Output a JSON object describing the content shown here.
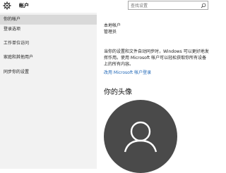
{
  "titlebar": {
    "icon": "gear-icon",
    "title": "帐户",
    "search_placeholder": "查找设置"
  },
  "sidebar": {
    "items": [
      {
        "label": "你的帐户",
        "selected": true
      },
      {
        "label": "登录选项",
        "selected": false
      },
      {
        "label": "工作单位访问",
        "selected": false
      },
      {
        "label": "家庭和其他用户",
        "selected": false
      },
      {
        "label": "同步你的设置",
        "selected": false
      }
    ]
  },
  "content": {
    "account_type": "本地帐户",
    "role": "管理员",
    "sync_text_line1": "当你的设置和文件自动同步时，Windows 可以更好地发",
    "sync_text_line2": "挥作用。使用 Microsoft 帐户可以轻松获取你所有设备",
    "sync_text_line3": "上的所有内容。",
    "ms_account_link": "改用 Microsoft 帐户登录",
    "avatar_heading": "你的头像"
  },
  "colors": {
    "sidebar_bg": "#f2f2f2",
    "selected_bg": "#d9d9d9",
    "link": "#1e66b6",
    "avatar_bg": "#4a4a4a"
  }
}
